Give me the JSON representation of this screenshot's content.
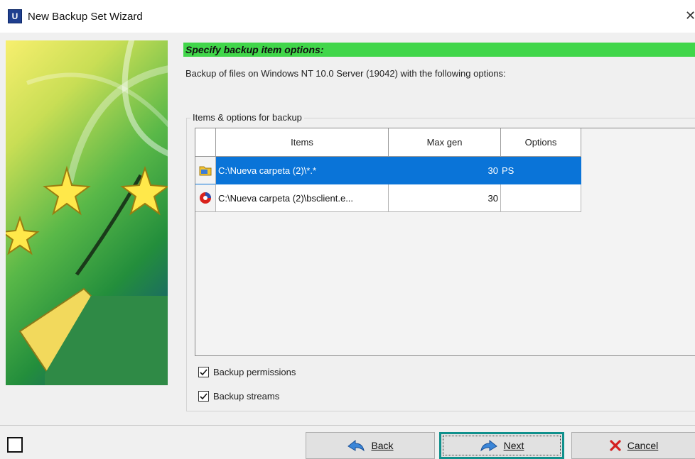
{
  "window": {
    "title": "New Backup Set Wizard",
    "icon_letter": "U",
    "close_glyph": "✕"
  },
  "step": {
    "header": "Specify backup item options:",
    "description": "Backup of files on Windows NT 10.0 Server (19042) with the following options:"
  },
  "group": {
    "title": "Items & options for backup",
    "columns": [
      "Items",
      "Max gen",
      "Options"
    ],
    "rows": [
      {
        "icon": "folder-icon",
        "item": "C:\\Nueva carpeta (2)\\*.*",
        "max_gen": "30",
        "options": "PS",
        "selected": true
      },
      {
        "icon": "executable-icon",
        "item": "C:\\Nueva carpeta (2)\\bsclient.e...",
        "max_gen": "30",
        "options": "",
        "selected": false
      }
    ]
  },
  "checkboxes": [
    {
      "label": "Backup permissions",
      "checked": true
    },
    {
      "label": "Backup streams",
      "checked": true
    }
  ],
  "buttons": {
    "back": "Back",
    "next": "Next",
    "cancel": "Cancel"
  },
  "colors": {
    "header_green": "#41d64a",
    "selection_blue": "#0a74d8",
    "focus_teal": "#10908c"
  }
}
